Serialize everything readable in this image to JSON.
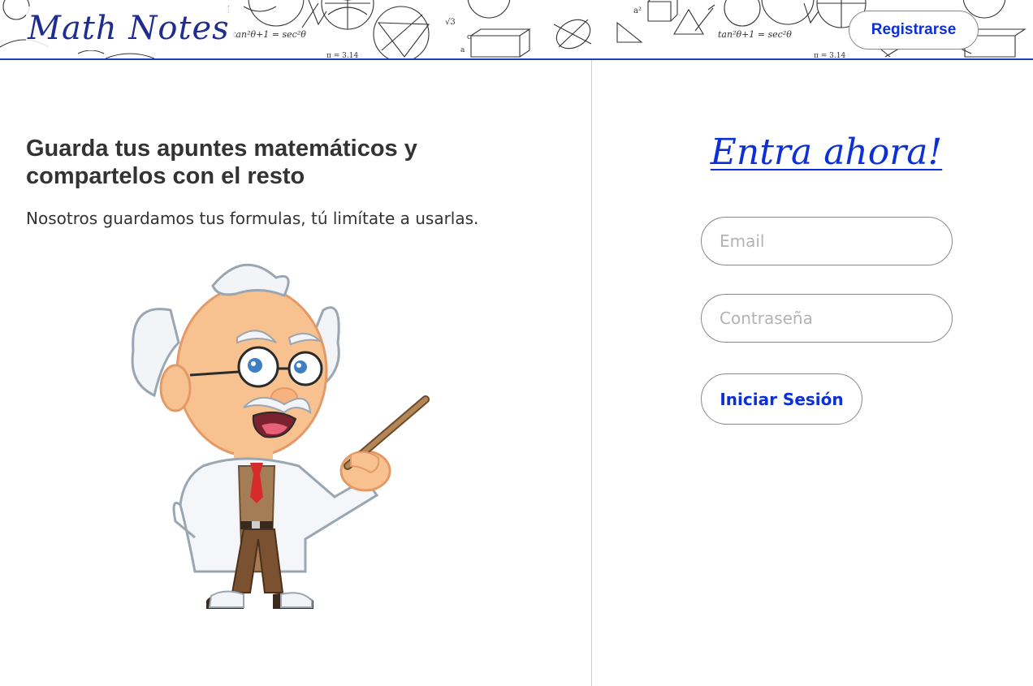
{
  "header": {
    "logo": "Math Notes",
    "register_label": "Registrarse",
    "accent": "#1f3fbf"
  },
  "hero": {
    "headline": "Guarda tus apuntes matemáticos y compartelos con el resto",
    "subtitle": "Nosotros guardamos tus formulas, tú limítate a usarlas."
  },
  "login": {
    "title": "Entra ahora!",
    "email_placeholder": "Email",
    "password_placeholder": "Contraseña",
    "submit_label": "Iniciar Sesión",
    "accent": "#0d2fd6"
  },
  "decorations": {
    "doodle_formula": "tan²θ+1 = sec²θ",
    "doodle_pi": "π = 3.14"
  },
  "icons": {
    "illustration": "professor-with-pointer-illustration"
  }
}
